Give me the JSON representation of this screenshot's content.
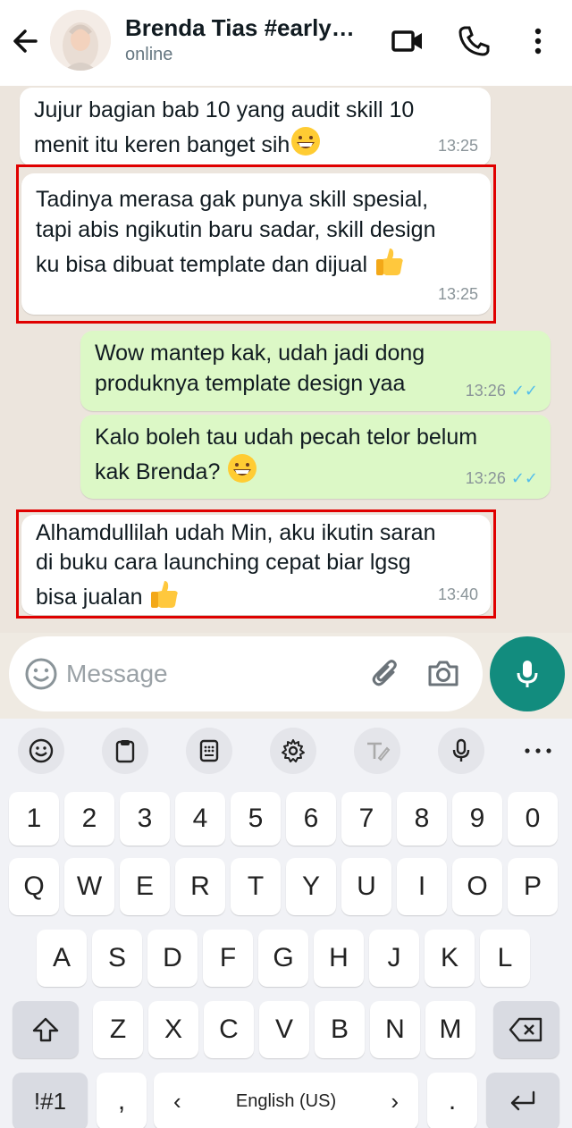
{
  "header": {
    "title": "Brenda Tias #early…",
    "status": "online",
    "icons": [
      "back-arrow-icon",
      "video-call-icon",
      "phone-icon",
      "more-vertical-icon"
    ]
  },
  "messages": [
    {
      "dir": "in",
      "lines": [
        "Jujur bagian bab 10 yang audit skill 10",
        "menit itu keren banget sih"
      ],
      "emoji": "grinning-face",
      "time": "13:25",
      "highlighted": false
    },
    {
      "dir": "in",
      "lines": [
        "Tadinya merasa gak punya skill spesial,",
        "tapi abis ngikutin baru sadar, skill design",
        "ku bisa dibuat template dan dijual"
      ],
      "emoji": "thumbs-up",
      "time": "13:25",
      "highlighted": true
    },
    {
      "dir": "out",
      "lines": [
        "Wow mantep kak, udah jadi dong",
        "produknya template design yaa"
      ],
      "time": "13:26",
      "read": true
    },
    {
      "dir": "out",
      "lines": [
        "Kalo boleh tau udah pecah telor belum",
        "kak Brenda?"
      ],
      "emoji": "grinning-face",
      "time": "13:26",
      "read": true
    },
    {
      "dir": "in",
      "lines": [
        "Alhamdullilah udah Min, aku ikutin saran",
        "di buku cara launching cepat biar lgsg",
        "bisa jualan"
      ],
      "emoji": "thumbs-up",
      "time": "13:40",
      "highlighted": true
    }
  ],
  "composer": {
    "placeholder": "Message",
    "icons": [
      "emoji-icon",
      "attach-icon",
      "camera-icon",
      "mic-icon"
    ]
  },
  "keyboard": {
    "toolbar": [
      "emoji-icon",
      "clipboard-icon",
      "keypad-icon",
      "settings-icon",
      "handwriting-icon",
      "mic-icon",
      "more-icon"
    ],
    "numbers": [
      "1",
      "2",
      "3",
      "4",
      "5",
      "6",
      "7",
      "8",
      "9",
      "0"
    ],
    "row1": [
      "Q",
      "W",
      "E",
      "R",
      "T",
      "Y",
      "U",
      "I",
      "O",
      "P"
    ],
    "row2": [
      "A",
      "S",
      "D",
      "F",
      "G",
      "H",
      "J",
      "K",
      "L"
    ],
    "row3": [
      "Z",
      "X",
      "C",
      "V",
      "B",
      "N",
      "M"
    ],
    "symbols_label": "!#1",
    "comma": ",",
    "space_label": "English (US)",
    "period": ".",
    "colors": {
      "accent": "#128c7e",
      "outgoing": "#dcf8c6",
      "highlight": "#e00000",
      "read_ticks": "#53bdeb"
    }
  }
}
